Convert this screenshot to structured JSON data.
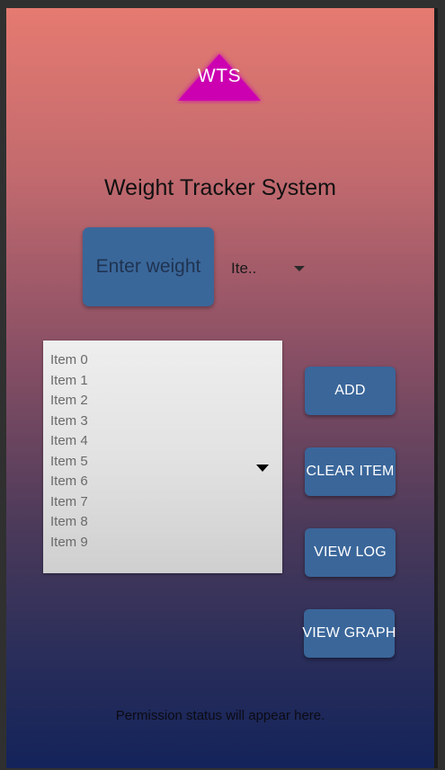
{
  "app": {
    "logo_text": "WTS",
    "title": "Weight Tracker System"
  },
  "weight_input": {
    "placeholder": "Enter weight"
  },
  "item_selector": {
    "selected": "Ite.."
  },
  "item_list": {
    "items": [
      "Item 0",
      "Item 1",
      "Item 2",
      "Item 3",
      "Item 4",
      "Item 5",
      "Item 6",
      "Item 7",
      "Item 8",
      "Item 9"
    ]
  },
  "buttons": {
    "add": "ADD",
    "clear_item": "CLEAR ITEM",
    "view_log": "VIEW LOG",
    "view_graph": "VIEW GRAPH"
  },
  "status": {
    "text": "Permission status will appear here."
  },
  "colors": {
    "button": "#3a669a",
    "logo": "#d000b0",
    "gradient_top": "#e57a70",
    "gradient_bottom": "#13235a"
  },
  "icons": {
    "logo": "triangle-logo",
    "dropdown": "chevron-down-icon"
  }
}
